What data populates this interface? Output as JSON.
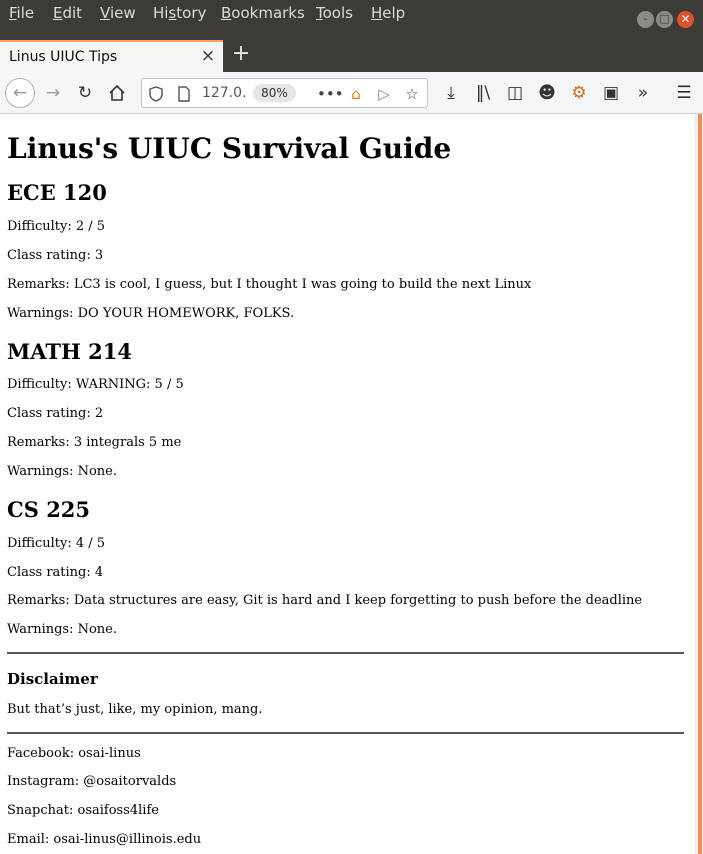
{
  "menubar": {
    "items": [
      {
        "accel": "F",
        "rest": "ile"
      },
      {
        "accel": "E",
        "rest": "dit"
      },
      {
        "accel": "V",
        "rest": "iew"
      },
      {
        "pre": "Hi",
        "accel": "s",
        "rest": "tory"
      },
      {
        "accel": "B",
        "rest": "ookmarks"
      },
      {
        "accel": "T",
        "rest": "ools"
      },
      {
        "accel": "H",
        "rest": "elp"
      }
    ]
  },
  "tab": {
    "title": "Linus UIUC Tips"
  },
  "urlbar": {
    "url": "127.0.",
    "zoom": "80%"
  },
  "page": {
    "title": "Linus's UIUC Survival Guide",
    "courses": [
      {
        "name": "ECE 120",
        "difficulty": "Difficulty: 2 / 5",
        "rating": "Class rating: 3",
        "remarks": "Remarks: LC3 is cool, I guess, but I thought I was going to build the next Linux",
        "warnings": "Warnings: DO YOUR HOMEWORK, FOLKS."
      },
      {
        "name": "MATH 214",
        "difficulty": "Difficulty: WARNING: 5 / 5",
        "rating": "Class rating: 2",
        "remarks": "Remarks: 3 integrals 5 me",
        "warnings": "Warnings: None."
      },
      {
        "name": "CS 225",
        "difficulty": "Difficulty: 4 / 5",
        "rating": "Class rating: 4",
        "remarks": "Remarks: Data structures are easy, Git is hard and I keep forgetting to push before the deadline",
        "warnings": "Warnings: None."
      }
    ],
    "disclaimer": {
      "heading": "Disclaimer",
      "text": "But that’s just, like, my opinion, mang."
    },
    "contacts": [
      "Facebook: osai-linus",
      "Instagram: @osaitorvalds",
      "Snapchat: osaifoss4life",
      "Email: osai-linus@illinois.edu"
    ]
  },
  "colors": {
    "menubar_bg": "#3c3b37",
    "tab_accent": "#ff9e63",
    "scrollbar_thumb": "#f08d5c",
    "close_button": "#e0502a"
  }
}
